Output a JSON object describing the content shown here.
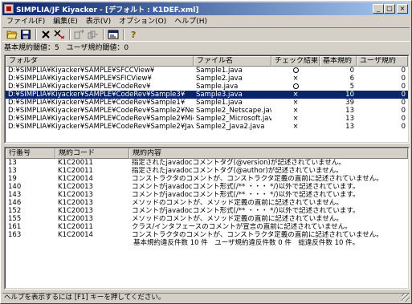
{
  "window": {
    "title": "SIMPLIA/JF Kiyacker - [デフォルト : K1DEF.xml]",
    "buttons": {
      "minimize": "_",
      "maximize": "□",
      "close": "×"
    }
  },
  "menu": [
    {
      "label": "ファイル(F)"
    },
    {
      "label": "編集(E)"
    },
    {
      "label": "表示(V)"
    },
    {
      "label": "オプション(O)"
    },
    {
      "label": "ヘルプ(H)"
    }
  ],
  "toolbar": {
    "icons": [
      "open-folder-icon",
      "save-icon",
      "delete-icon",
      "clear-results-icon",
      "check-icon",
      "check-all-icon",
      "properties-icon",
      "help-icon"
    ],
    "glyphs": [
      "📂",
      "💾",
      "✕",
      "✕",
      "⇄",
      "⇉",
      "⧉",
      "?"
    ]
  },
  "thresholds": {
    "basic_label": "基本規約閾値：5",
    "user_label": "ユーザ規約閾値：0"
  },
  "files_table": {
    "columns": [
      "フォルダ",
      "ファイル名",
      "チェック結果",
      "基本規約",
      "ユーザ規約"
    ],
    "rows": [
      {
        "folder": "D:¥SIMPLIA¥Kiyacker¥SAMPLE¥SFCCView¥",
        "file": "Sample1.java",
        "result": "○",
        "basic": "0",
        "user": "0",
        "selected": false
      },
      {
        "folder": "D:¥SIMPLIA¥Kiyacker¥SAMPLE¥SFICView¥",
        "file": "Sample2.java",
        "result": "×",
        "basic": "6",
        "user": "0",
        "selected": false
      },
      {
        "folder": "D:¥SIMPLIA¥Kiyacker¥SAMPLE¥CodeRev¥",
        "file": "Sample.java",
        "result": "○",
        "basic": "5",
        "user": "0",
        "selected": false
      },
      {
        "folder": "D:¥SIMPLIA¥Kiyacker¥SAMPLE¥CodeRev¥Sample3¥",
        "file": "Sample3.java",
        "result": "×",
        "basic": "10",
        "user": "0",
        "selected": true
      },
      {
        "folder": "D:¥SIMPLIA¥Kiyacker¥SAMPLE¥CodeRev¥Sample1¥",
        "file": "Sample1.java",
        "result": "×",
        "basic": "39",
        "user": "0",
        "selected": false
      },
      {
        "folder": "D:¥SIMPLIA¥Kiyacker¥SAMPLE¥CodeRev¥Sample2¥Netscape¥",
        "file": "Sample2_Netscape.java",
        "result": "×",
        "basic": "13",
        "user": "0",
        "selected": false
      },
      {
        "folder": "D:¥SIMPLIA¥Kiyacker¥SAMPLE¥CodeRev¥Sample2¥Microsoft¥",
        "file": "Sample2_Microsoft.java",
        "result": "×",
        "basic": "13",
        "user": "0",
        "selected": false
      },
      {
        "folder": "D:¥SIMPLIA¥Kiyacker¥SAMPLE¥CodeRev¥Sample2¥Java2¥",
        "file": "Sample2_Java2.java",
        "result": "×",
        "basic": "13",
        "user": "0",
        "selected": false
      }
    ]
  },
  "violations_table": {
    "columns": [
      "行番号",
      "規約コード",
      "規約内容"
    ],
    "rows": [
      {
        "line": "13",
        "code": "K1C20011",
        "text": "指定されたjavadocコメントタグ(@version)が記述されていません。"
      },
      {
        "line": "13",
        "code": "K1C20011",
        "text": "指定されたjavadocコメントタグ(@author)が記述されていません。"
      },
      {
        "line": "19",
        "code": "K1C20014",
        "text": "コンストラクタのコメントが、コンストラクタ定義の直前に記述されていません。"
      },
      {
        "line": "140",
        "code": "K1C20013",
        "text": "コメントがjavadocコメント形式(/** ・・・ */)以外で記述されています。"
      },
      {
        "line": "143",
        "code": "K1C20013",
        "text": "コメントがjavadocコメント形式(/** ・・・ */)以外で記述されています。"
      },
      {
        "line": "146",
        "code": "K1C20013",
        "text": "メソッドのコメントが、メソッド定義の直前に記述されていません。"
      },
      {
        "line": "152",
        "code": "K1C20013",
        "text": "コメントがjavadocコメント形式(/** ・・・ */)以外で記述されています。"
      },
      {
        "line": "155",
        "code": "K1C20013",
        "text": "メソッドのコメントが、メソッド定義の直前に記述されていません。"
      },
      {
        "line": "161",
        "code": "K1C20011",
        "text": "クラス/インタフェースのコメントが宣言の直前に記述されていません。"
      },
      {
        "line": "163",
        "code": "K1C20014",
        "text": "コンストラクタのコメントが、コンストラクタ定義の直前に記述されていません。"
      }
    ],
    "summary": "基本規約違反件数 10 件　ユーザ規約違反件数 0 件　総違反件数 10 件。"
  },
  "statusbar": {
    "text": "ヘルプを表示するには [F1] キーを押してください。"
  },
  "colors": {
    "selection": "#0a246a",
    "titlebar_start": "#0a246a",
    "titlebar_end": "#a6caf0",
    "face": "#d4d0c8"
  }
}
